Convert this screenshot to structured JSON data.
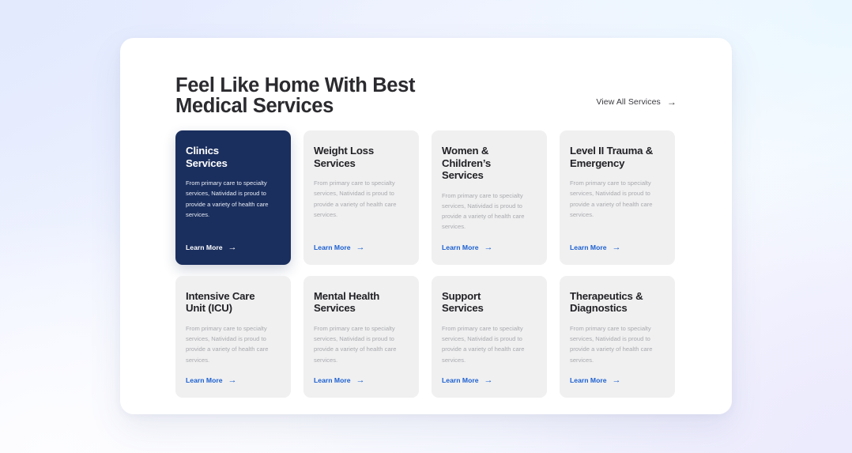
{
  "header": {
    "headline_line1": "Feel Like Home With Best",
    "headline_line2": "Medical Services",
    "view_all_label": "View All Services",
    "view_all_arrow": "→"
  },
  "common": {
    "body_text": "From primary care to specialty services, Natividad is proud to provide a variety of health care services.",
    "learn_more_label": "Learn More",
    "arrow": "→"
  },
  "colors": {
    "featured_card_bg": "#1b2f5e",
    "card_bg": "#f0f0f1",
    "link_blue": "#1a5fd0",
    "panel_bg": "#ffffff",
    "title_text": "#222226",
    "body_text": "#a9aaae"
  },
  "cards": [
    {
      "title": "Clinics\nServices",
      "body": "From primary care to specialty services, Natividad is proud to provide a variety of health care services.",
      "link_label": "Learn More",
      "featured": true
    },
    {
      "title": "Weight Loss\nServices",
      "body": "From primary care to specialty services, Natividad is proud to provide a variety of health care services.",
      "link_label": "Learn More",
      "featured": false
    },
    {
      "title": "Women &\nChildren’s Services",
      "body": "From primary care to specialty services, Natividad is proud to provide a variety of health care services.",
      "link_label": "Learn More",
      "featured": false
    },
    {
      "title": "Level II Trauma &\nEmergency",
      "body": "From primary care to specialty services, Natividad is proud to provide a variety of health care services.",
      "link_label": "Learn More",
      "featured": false
    },
    {
      "title": "Intensive Care\nUnit (ICU)",
      "body": "From primary care to specialty services, Natividad is proud to provide a variety of health care services.",
      "link_label": "Learn More",
      "featured": false
    },
    {
      "title": "Mental Health\nServices",
      "body": "From primary care to specialty services, Natividad is proud to provide a variety of health care services.",
      "link_label": "Learn More",
      "featured": false
    },
    {
      "title": "Support\nServices",
      "body": "From primary care to specialty services, Natividad is proud to provide a variety of health care services.",
      "link_label": "Learn More",
      "featured": false
    },
    {
      "title": "Therapeutics &\nDiagnostics",
      "body": "From primary care to specialty services, Natividad is proud to provide a variety of health care services.",
      "link_label": "Learn More",
      "featured": false
    }
  ]
}
